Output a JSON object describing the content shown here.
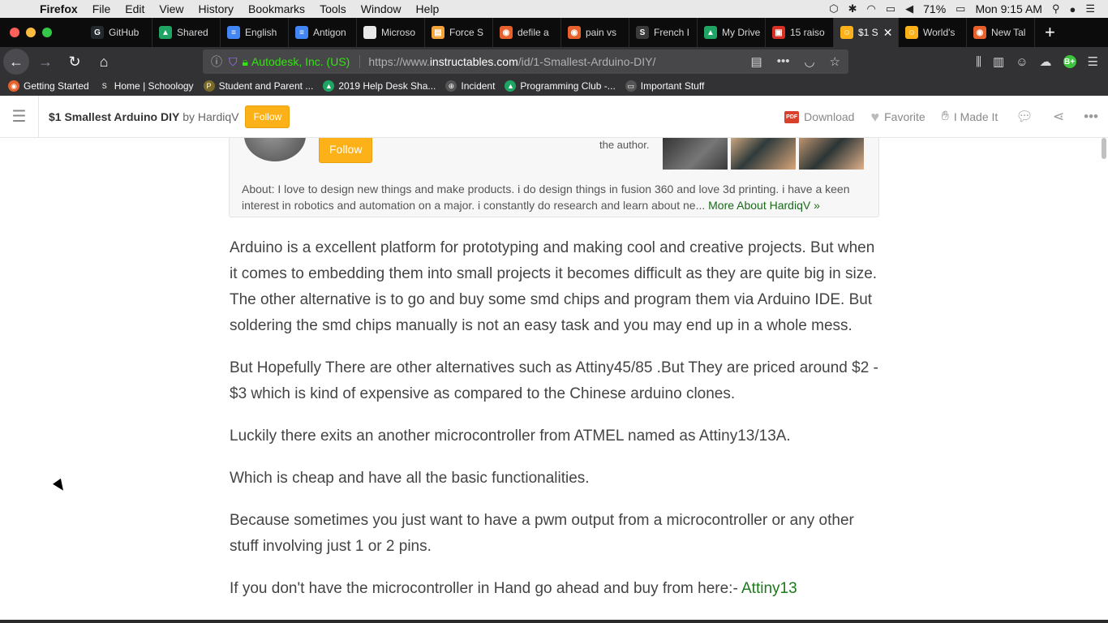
{
  "menubar": {
    "app": "Firefox",
    "items": [
      "File",
      "Edit",
      "View",
      "History",
      "Bookmarks",
      "Tools",
      "Window",
      "Help"
    ],
    "battery": "71%",
    "clock": "Mon 9:15 AM"
  },
  "tabs": [
    {
      "label": "GitHub",
      "color": "#24292e",
      "glyph": "G"
    },
    {
      "label": "Shared",
      "color": "#1fa463",
      "glyph": "▲"
    },
    {
      "label": "English",
      "color": "#4285f4",
      "glyph": "≡"
    },
    {
      "label": "Antigon",
      "color": "#4285f4",
      "glyph": "≡"
    },
    {
      "label": "Microso",
      "color": "#e8e8e8",
      "glyph": ""
    },
    {
      "label": "Force S",
      "color": "#f3a33a",
      "glyph": "▤"
    },
    {
      "label": "defile a",
      "color": "#e8612c",
      "glyph": "◉"
    },
    {
      "label": "pain vs",
      "color": "#e8612c",
      "glyph": "◉"
    },
    {
      "label": "French I",
      "color": "#3a3a3a",
      "glyph": "S"
    },
    {
      "label": "My Drive",
      "color": "#1fa463",
      "glyph": "▲"
    },
    {
      "label": "15 raiso",
      "color": "#d93025",
      "glyph": "▣"
    },
    {
      "label": "$1 S",
      "color": "#fbb117",
      "glyph": "☺",
      "active": true
    },
    {
      "label": "World's",
      "color": "#fbb117",
      "glyph": "☺"
    },
    {
      "label": "New Tal",
      "color": "#e8612c",
      "glyph": "◉"
    }
  ],
  "urlbar": {
    "org": "Autodesk, Inc. (US)",
    "url_prefix": "https://www.",
    "url_domain": "instructables.com",
    "url_path": "/id/1-Smallest-Arduino-DIY/"
  },
  "bookmarks": [
    {
      "label": "Getting Started",
      "color": "#e8612c",
      "glyph": "◉"
    },
    {
      "label": "Home | Schoology",
      "color": "#333",
      "glyph": "S"
    },
    {
      "label": "Student and Parent ...",
      "color": "#7a6a2a",
      "glyph": "P"
    },
    {
      "label": "2019 Help Desk Sha...",
      "color": "#1fa463",
      "glyph": "▲"
    },
    {
      "label": "Incident",
      "color": "#555",
      "glyph": "⊕"
    },
    {
      "label": "Programming Club -...",
      "color": "#1fa463",
      "glyph": "▲"
    },
    {
      "label": "Important Stuff",
      "color": "#555",
      "glyph": "▭"
    }
  ],
  "header": {
    "title": "$1 Smallest Arduino DIY",
    "by": "by",
    "author": "HardiqV",
    "follow": "Follow",
    "download": "Download",
    "pdf": "PDF",
    "favorite": "Favorite",
    "made_it": "I Made It"
  },
  "author_box": {
    "follow": "Follow",
    "note": "the author.",
    "about": "About: I love to design new things and make products. i do design things in fusion 360 and love 3d printing. i have a keen interest in robotics and automation on a major. i constantly do research and learn about ne...",
    "more_link": "More About HardiqV »"
  },
  "article": {
    "p1": "Arduino is a excellent platform for prototyping and making cool and creative projects. But when it comes to embedding them into small projects it becomes difficult as they are quite big in size. The other alternative is to go and buy some smd chips and program them via Arduino IDE. But soldering the smd chips manually is not an easy task and you may end up in a whole mess.",
    "p2": "But Hopefully There are other alternatives such as Attiny45/85 .But They are priced around $2 - $3 which is kind of expensive as compared to the Chinese arduino clones.",
    "p3": "Luckily there exits an another microcontroller from ATMEL named as Attiny13/13A.",
    "p4": "Which is cheap and have all the basic functionalities.",
    "p5": "Because sometimes you just want to have a pwm output from a microcontroller or any other stuff involving just 1 or 2 pins.",
    "p6_text": "If you don't have the microcontroller in Hand go ahead and buy from here:- ",
    "p6_link": "Attiny13"
  }
}
